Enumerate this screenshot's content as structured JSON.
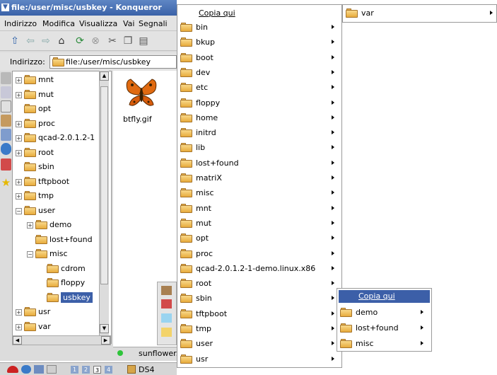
{
  "window": {
    "title": "file:/user/misc/usbkey - Konqueror"
  },
  "menubar": {
    "items": [
      "Indirizzo",
      "Modifica",
      "Visualizza",
      "Vai",
      "Segnali"
    ]
  },
  "location": {
    "label": "Indirizzo:",
    "value": "file:/user/misc/usbkey"
  },
  "tree": {
    "items": [
      {
        "label": "mnt"
      },
      {
        "label": "mut"
      },
      {
        "label": "opt"
      },
      {
        "label": "proc"
      },
      {
        "label": "qcad-2.0.1.2-1"
      },
      {
        "label": "root"
      },
      {
        "label": "sbin"
      },
      {
        "label": "tftpboot"
      },
      {
        "label": "tmp"
      },
      {
        "label": "user"
      },
      {
        "label": "demo"
      },
      {
        "label": "lost+found"
      },
      {
        "label": "misc"
      },
      {
        "label": "cdrom"
      },
      {
        "label": "floppy"
      },
      {
        "label": "usbkey"
      },
      {
        "label": "usr"
      },
      {
        "label": "var"
      }
    ]
  },
  "file": {
    "name": "btfly.gif"
  },
  "status": {
    "text": "sunflower."
  },
  "taskbar": {
    "pages": [
      "1",
      "2",
      "3",
      "4"
    ],
    "task": "DS4"
  },
  "menu1": {
    "header": "Copia qui",
    "items": [
      "bin",
      "bkup",
      "boot",
      "dev",
      "etc",
      "floppy",
      "home",
      "initrd",
      "lib",
      "lost+found",
      "matriX",
      "misc",
      "mnt",
      "mut",
      "opt",
      "proc",
      "qcad-2.0.1.2-1-demo.linux.x86",
      "root",
      "sbin",
      "tftpboot",
      "tmp",
      "user",
      "usr"
    ]
  },
  "menu2": {
    "item": "var"
  },
  "menu3": {
    "header": "Copia qui",
    "items": [
      "demo",
      "lost+found",
      "misc"
    ]
  },
  "colors": {
    "highlight": "#3c5fa8",
    "titlebar": "#3a62a8",
    "folder": "#e8ab3c"
  }
}
